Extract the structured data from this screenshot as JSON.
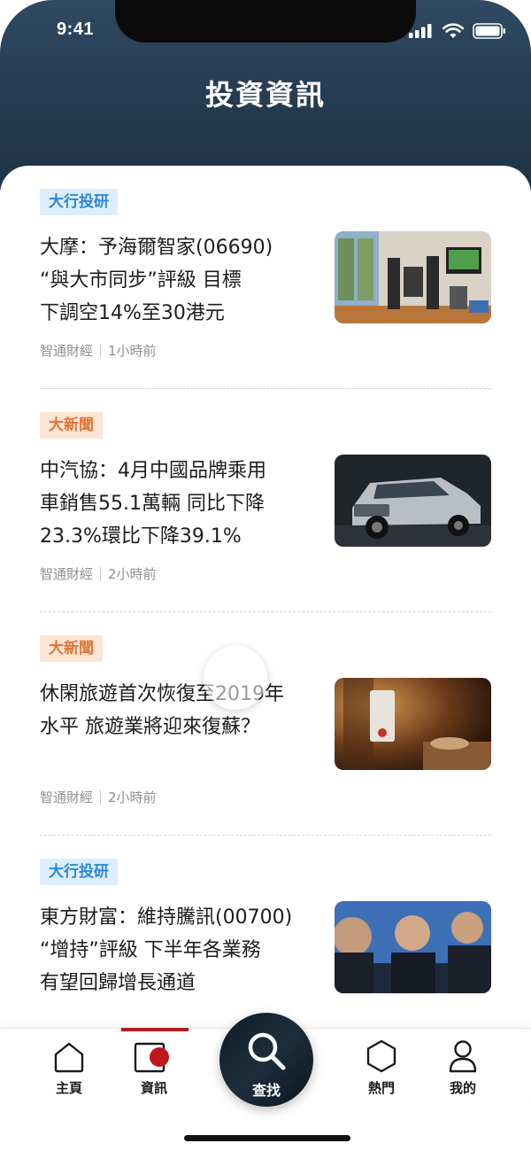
{
  "status_bar": {
    "time": "9:41"
  },
  "header": {
    "title": "投資資訊"
  },
  "articles": [
    {
      "tag": "大行投研",
      "tag_color": "#2e86d6",
      "title_lines": [
        "大摩：予海爾智家(06690)",
        "“與大市同步”評級 目標",
        "下調空14%至30港元"
      ],
      "source": "智通財經",
      "time": "1小時前",
      "image": "home-theater-living-room"
    },
    {
      "tag": "大新聞",
      "tag_color": "#e27434",
      "title_lines": [
        "中汽協：4月中國品牌乘用",
        "車銷售55.1萬輛 同比下降",
        "23.3%環比下降39.1%"
      ],
      "source": "智通財經",
      "time": "2小時前",
      "image": "silver-suv"
    },
    {
      "tag": "大新聞",
      "tag_color": "#e27434",
      "title_lines": [
        "休閑旅遊首次恢復至2019年",
        "水平 旅遊業將迎來復蘇？"
      ],
      "source": "智通財經",
      "time": "2小時前",
      "image": "hotel-door-hanger"
    },
    {
      "tag": "大行投研",
      "tag_color": "#2e86d6",
      "title_lines": [
        "東方財富：維持騰訊(00700)",
        "“增持”評級 下半年各業務",
        "有望回歸增長通道"
      ],
      "source": "",
      "time": "",
      "image": "press-conference-men"
    }
  ],
  "tabbar": {
    "items": [
      {
        "label": "主頁",
        "icon": "home-icon"
      },
      {
        "label": "資訊",
        "icon": "news-icon"
      },
      {
        "label": "查找",
        "icon": "search-icon"
      },
      {
        "label": "熱門",
        "icon": "hexagon-icon"
      },
      {
        "label": "我的",
        "icon": "user-icon"
      }
    ],
    "active": "資訊",
    "accent": "#b01e1e"
  }
}
